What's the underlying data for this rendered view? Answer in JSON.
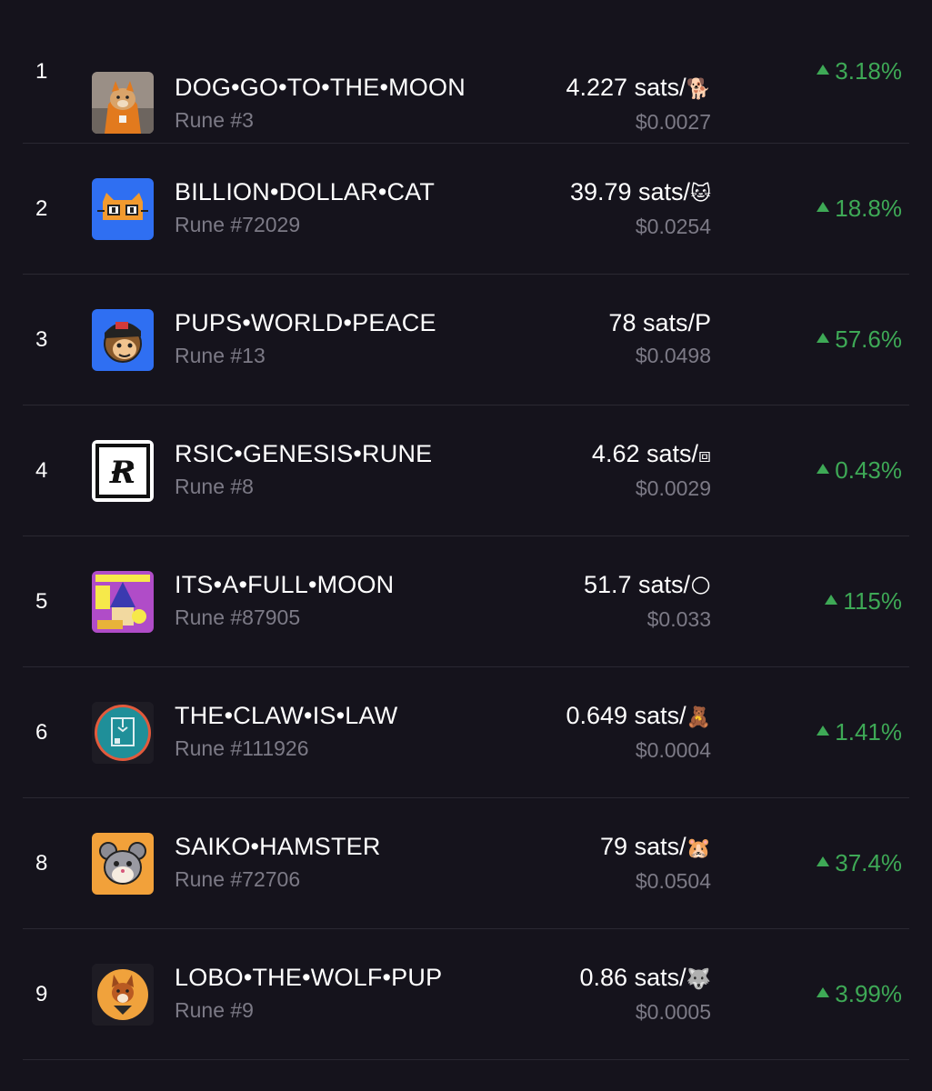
{
  "colors": {
    "background": "#15131c",
    "divider": "#2a2832",
    "positive": "#3ea956",
    "muted_text": "#7c7a86",
    "primary_text": "#ffffff"
  },
  "runes": [
    {
      "rank": "1",
      "name": "DOG•GO•TO•THE•MOON",
      "id": "Rune #3",
      "price": "4.227 sats/",
      "symbol": "🐕",
      "usd": "$0.0027",
      "change": "3.18%",
      "thumb_icon": "dog-hoodie-icon"
    },
    {
      "rank": "2",
      "name": "BILLION•DOLLAR•CAT",
      "id": "Rune #72029",
      "price": "39.79 sats/",
      "symbol": "🐱",
      "usd": "$0.0254",
      "change": "18.8%",
      "thumb_icon": "cat-face-icon"
    },
    {
      "rank": "3",
      "name": "PUPS•WORLD•PEACE",
      "id": "Rune #13",
      "price": "78 sats/",
      "symbol": "P",
      "usd": "$0.0498",
      "change": "57.6%",
      "thumb_icon": "monkey-cap-icon"
    },
    {
      "rank": "4",
      "name": "RSIC•GENESIS•RUNE",
      "id": "Rune #8",
      "price": "4.62 sats/",
      "symbol": "⧈",
      "usd": "$0.0029",
      "change": "0.43%",
      "thumb_icon": "r-logo-icon"
    },
    {
      "rank": "5",
      "name": "ITS•A•FULL•MOON",
      "id": "Rune #87905",
      "price": "51.7 sats/",
      "symbol": "🌕",
      "usd": "$0.033",
      "change": "115%",
      "thumb_icon": "wizard-moon-icon"
    },
    {
      "rank": "6",
      "name": "THE•CLAW•IS•LAW",
      "id": "Rune #111926",
      "price": "0.649 sats/",
      "symbol": "🧸",
      "usd": "$0.0004",
      "change": "1.41%",
      "thumb_icon": "claw-machine-icon"
    },
    {
      "rank": "8",
      "name": "SAIKO•HAMSTER",
      "id": "Rune #72706",
      "price": "79 sats/",
      "symbol": "🐹",
      "usd": "$0.0504",
      "change": "37.4%",
      "thumb_icon": "hamster-icon"
    },
    {
      "rank": "9",
      "name": "LOBO•THE•WOLF•PUP",
      "id": "Rune #9",
      "price": "0.86 sats/",
      "symbol": "🐺",
      "usd": "$0.0005",
      "change": "3.99%",
      "thumb_icon": "wolf-pup-icon"
    }
  ]
}
